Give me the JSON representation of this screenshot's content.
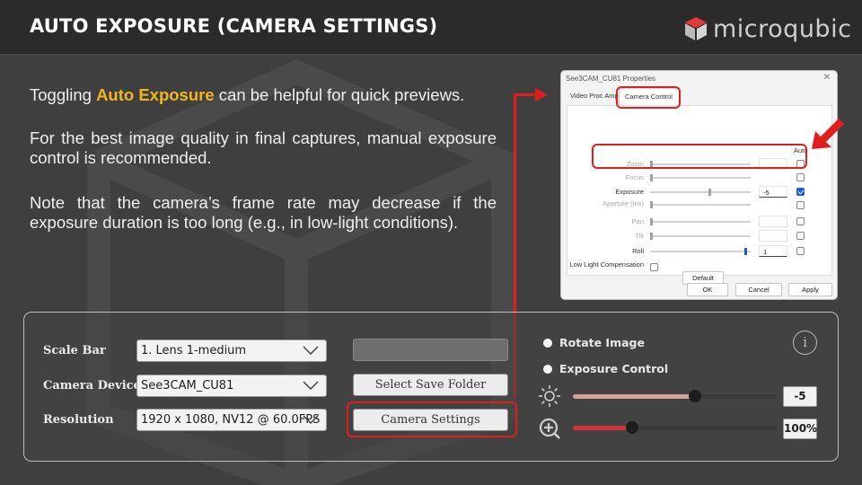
{
  "slide": {
    "title": "AUTO EXPOSURE (CAMERA SETTINGS)",
    "logo_text": "microqubic",
    "p1_before": "Toggling ",
    "p1_highlight": "Auto Exposure",
    "p1_after": " can be helpful for quick previews.",
    "p2": "For the best image quality in final captures, manual exposure control is recommended.",
    "p3": "Note that the camera’s frame rate may decrease if the exposure duration is too long (e.g., in low-light conditions)."
  },
  "dialog": {
    "title": "See3CAM_CU81 Properties",
    "close": "✕",
    "tab_video": "Video Proc Amp",
    "tab_camera": "Camera Control",
    "auto_header": "Auto",
    "rows": [
      {
        "label": "Zoom",
        "value": ""
      },
      {
        "label": "Focus",
        "value": ""
      },
      {
        "label": "Exposure",
        "value": "-5"
      },
      {
        "label": "Aperture (Iris)",
        "value": ""
      },
      {
        "label": "Pan",
        "value": ""
      },
      {
        "label": "Tilt",
        "value": ""
      },
      {
        "label": "Roll",
        "value": "1"
      }
    ],
    "low_light": "Low Light Compensation",
    "default_btn": "Default",
    "ok_btn": "OK",
    "cancel_btn": "Cancel",
    "apply_btn": "Apply",
    "exposure_auto_checked": true
  },
  "panel": {
    "scale_bar_label": "Scale Bar",
    "scale_bar_value": "1. Lens 1-medium",
    "camera_devices_label": "Camera Devices",
    "camera_devices_value": "See3CAM_CU81",
    "resolution_label": "Resolution",
    "resolution_value": "1920 x 1080, NV12 @ 60.0FPS",
    "select_save_folder": "Select Save Folder",
    "camera_settings": "Camera Settings",
    "rotate_image": "Rotate Image",
    "exposure_control": "Exposure Control",
    "info": "i",
    "exposure_value": "-5",
    "exposure_slider_fraction": 0.6,
    "zoom_value": "100%",
    "zoom_slider_fraction": 0.29
  },
  "colors": {
    "highlight": "#f5b51c",
    "annotation_red": "#e11e1e",
    "exposure_track": "#d9a0a0",
    "zoom_track": "#d0323c"
  }
}
